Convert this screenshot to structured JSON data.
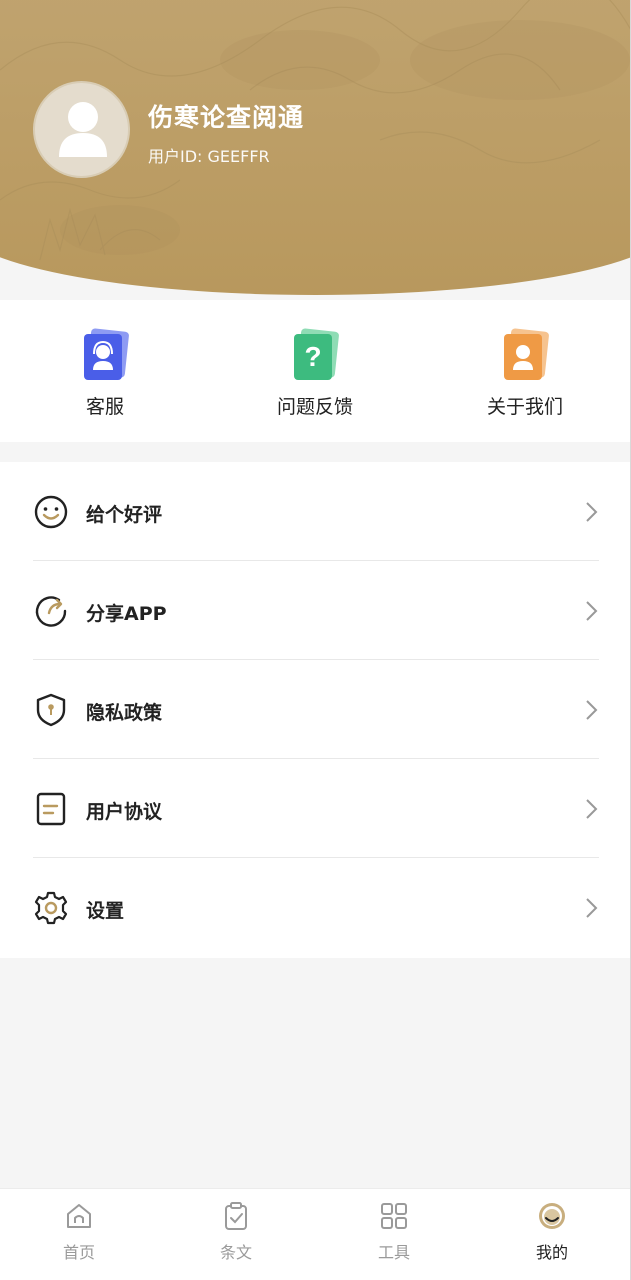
{
  "header": {
    "app_name": "伤寒论查阅通",
    "user_id": "用户ID: GEEFFR"
  },
  "quick_actions": [
    {
      "label": "客服",
      "icon": "customer-service-icon",
      "color": "#4a5ee8"
    },
    {
      "label": "问题反馈",
      "icon": "question-icon",
      "color": "#3dbb7f"
    },
    {
      "label": "关于我们",
      "icon": "about-us-icon",
      "color": "#ef9a45"
    }
  ],
  "menu": {
    "items": [
      {
        "label": "给个好评",
        "icon": "smile-icon"
      },
      {
        "label": "分享APP",
        "icon": "share-icon"
      },
      {
        "label": "隐私政策",
        "icon": "shield-icon"
      },
      {
        "label": "用户协议",
        "icon": "document-icon"
      },
      {
        "label": "设置",
        "icon": "gear-icon"
      }
    ]
  },
  "tabbar": {
    "tabs": [
      {
        "label": "首页",
        "icon": "home-icon"
      },
      {
        "label": "条文",
        "icon": "clipboard-icon"
      },
      {
        "label": "工具",
        "icon": "grid-icon"
      },
      {
        "label": "我的",
        "icon": "profile-icon"
      }
    ],
    "active": "我的"
  },
  "colors": {
    "accent": "#b99a5f",
    "header_bg": "#c0a36e"
  }
}
